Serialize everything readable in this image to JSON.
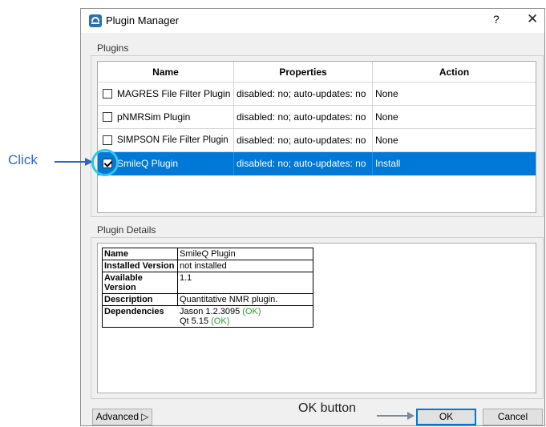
{
  "window": {
    "title": "Plugin Manager",
    "help_label": "?",
    "close_label": "✕"
  },
  "plugins_group": {
    "label": "Plugins",
    "columns": [
      "Name",
      "Properties",
      "Action"
    ],
    "rows": [
      {
        "name": "MAGRES File Filter Plugin",
        "properties": "disabled: no; auto-updates: no",
        "action": "None",
        "checked": false,
        "selected": false
      },
      {
        "name": "pNMRSim Plugin",
        "properties": "disabled: no; auto-updates: no",
        "action": "None",
        "checked": false,
        "selected": false
      },
      {
        "name": "SIMPSON File Filter Plugin",
        "properties": "disabled: no; auto-updates: no",
        "action": "None",
        "checked": false,
        "selected": false
      },
      {
        "name": "SmileQ Plugin",
        "properties": "disabled: no; auto-updates: no",
        "action": "Install",
        "checked": true,
        "selected": true
      }
    ]
  },
  "details_group": {
    "label": "Plugin Details",
    "name_key": "Name",
    "name_value": "SmileQ Plugin",
    "installed_key": "Installed Version",
    "installed_value": "not installed",
    "available_key": "Available Version",
    "available_value": "1.1",
    "description_key": "Description",
    "description_value": "Quantitative NMR plugin.",
    "dependencies_key": "Dependencies",
    "dep1_name": "Jason 1.2.3095",
    "dep1_status": "(OK)",
    "dep2_name": "Qt 5.15",
    "dep2_status": "(OK)"
  },
  "buttons": {
    "advanced": "Advanced",
    "advanced_arrow": "▷",
    "ok": "OK",
    "cancel": "Cancel"
  },
  "annotations": {
    "click": "Click",
    "ok_button": "OK button"
  },
  "colors": {
    "selection": "#0078d7",
    "annotation_blue": "#2f66c4",
    "highlight": "#2dc7e8",
    "ok_green": "#2e9a2e"
  },
  "icons": {
    "app": "plugin-manager-icon",
    "help": "question-icon",
    "close": "close-icon"
  }
}
